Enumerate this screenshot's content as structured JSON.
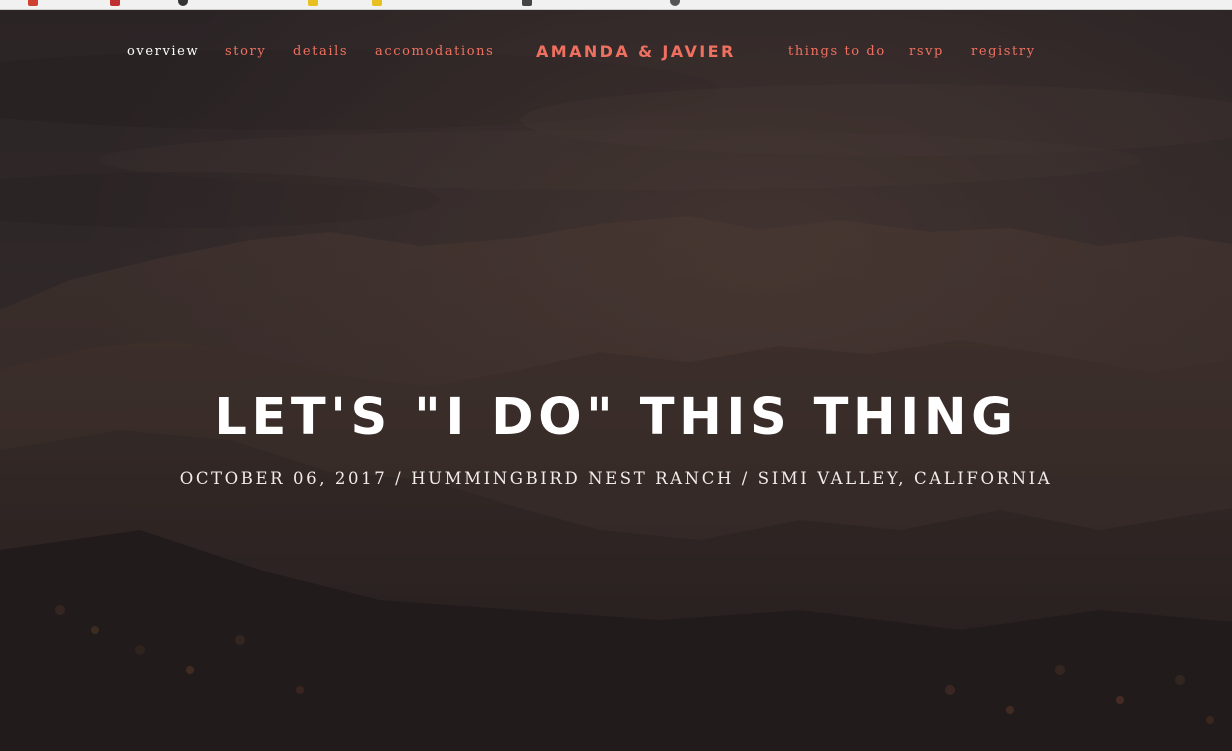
{
  "colors": {
    "accent": "#f07060",
    "nav_active": "#ffffff",
    "headline": "#ffffff",
    "background_dark": "#2b2424"
  },
  "nav": {
    "left_items": [
      {
        "label": "overview",
        "active": true
      },
      {
        "label": "story",
        "active": false
      },
      {
        "label": "details",
        "active": false
      },
      {
        "label": "accomodations",
        "active": false
      }
    ],
    "brand": "AMANDA & JAVIER",
    "right_items": [
      {
        "label": "things to do",
        "active": false
      },
      {
        "label": "rsvp",
        "active": false
      },
      {
        "label": "registry",
        "active": false
      }
    ]
  },
  "hero": {
    "headline": "LET'S \"I DO\" THIS THING",
    "subline": "OCTOBER 06, 2017 / HUMMINGBIRD NEST RANCH / SIMI VALLEY, CALIFORNIA"
  }
}
